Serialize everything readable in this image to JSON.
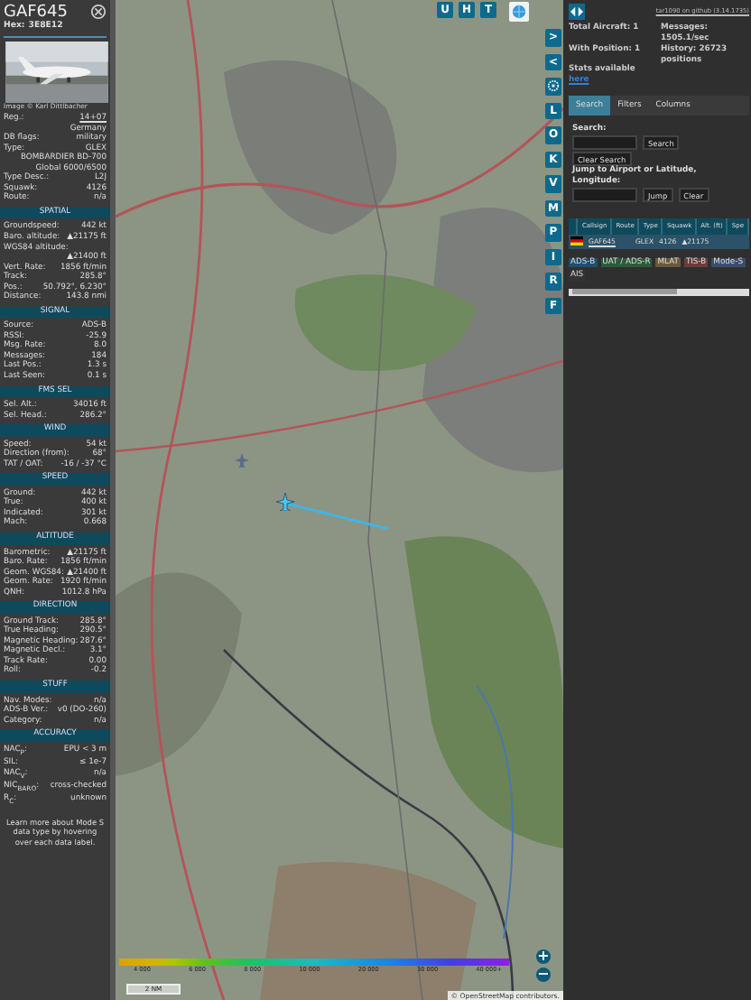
{
  "aircraft": {
    "callsign": "GAF645",
    "hex_label": "Hex:",
    "hex": "3E8E12",
    "photo": {
      "kind": "picture"
    },
    "photo_credit": "Image © Karl Dittlbacher"
  },
  "details": [
    {
      "label": "Reg.:",
      "value": "14+07",
      "link": true
    },
    {
      "value": "Germany"
    },
    {
      "label": "DB flags:",
      "value": "military"
    },
    {
      "label": "Type:",
      "value": "GLEX"
    },
    {
      "value": "BOMBARDIER BD-700 Global 6000/6500"
    },
    {
      "label": "Type Desc.:",
      "value": "L2J"
    },
    {
      "label": "Squawk:",
      "value": "4126"
    },
    {
      "label": "Route:",
      "value": "n/a"
    }
  ],
  "sections": [
    {
      "title": "SPATIAL",
      "rows": [
        {
          "label": "Groundspeed:",
          "value": "442 kt"
        },
        {
          "label": "Baro. altitude:",
          "value": "▲21175 ft"
        },
        {
          "label": "WGS84 altitude:"
        },
        {
          "value": "▲21400 ft"
        },
        {
          "label": "Vert. Rate:",
          "value": "1856 ft/min"
        },
        {
          "label": "Track:",
          "value": "285.8°"
        },
        {
          "label": "Pos.:",
          "value": "50.792°, 6.230°"
        },
        {
          "label": "Distance:",
          "value": "143.8 nmi"
        }
      ]
    },
    {
      "title": "SIGNAL",
      "rows": [
        {
          "label": "Source:",
          "value": "ADS-B"
        },
        {
          "label": "RSSI:",
          "value": "-25.9"
        },
        {
          "label": "Msg. Rate:",
          "value": "8.0"
        },
        {
          "label": "Messages:",
          "value": "184"
        },
        {
          "label": "Last Pos.:",
          "value": "1.3 s"
        },
        {
          "label": "Last Seen:",
          "value": "0.1 s"
        }
      ]
    },
    {
      "title": "FMS SEL",
      "rows": [
        {
          "label": "Sel. Alt.:",
          "value": "34016 ft"
        },
        {
          "label": "Sel. Head.:",
          "value": "286.2°"
        }
      ]
    },
    {
      "title": "WIND",
      "rows": [
        {
          "label": "Speed:",
          "value": "54 kt"
        },
        {
          "label": "Direction (from):",
          "value": "68°"
        },
        {
          "label": "TAT / OAT:",
          "value": "-16 / -37 °C"
        }
      ]
    },
    {
      "title": "SPEED",
      "rows": [
        {
          "label": "Ground:",
          "value": "442 kt"
        },
        {
          "label": "True:",
          "value": "400 kt"
        },
        {
          "label": "Indicated:",
          "value": "301 kt"
        },
        {
          "label": "Mach:",
          "value": "0.668"
        }
      ]
    },
    {
      "title": "ALTITUDE",
      "rows": [
        {
          "label": "Barometric:",
          "value": "▲21175 ft"
        },
        {
          "label": "Baro. Rate:",
          "value": "1856 ft/min"
        },
        {
          "label": "Geom. WGS84:",
          "value": "▲21400 ft"
        },
        {
          "label": "Geom. Rate:",
          "value": "1920 ft/min"
        },
        {
          "label": "QNH:",
          "value": "1012.8 hPa"
        }
      ]
    },
    {
      "title": "DIRECTION",
      "rows": [
        {
          "label": "Ground Track:",
          "value": "285.8°"
        },
        {
          "label": "True Heading:",
          "value": "290.5°"
        },
        {
          "label": "Magnetic Heading:",
          "value": "287.6°"
        },
        {
          "label": "Magnetic Decl.:",
          "value": "3.1°"
        },
        {
          "label": "Track Rate:",
          "value": "0.00"
        },
        {
          "label": "Roll:",
          "value": "-0.2"
        }
      ]
    },
    {
      "title": "STUFF",
      "rows": [
        {
          "label": "Nav. Modes:",
          "value": "n/a"
        },
        {
          "label": "ADS-B Ver.:",
          "value": "v0 (DO-260)"
        },
        {
          "label": "Category:",
          "value": "n/a"
        }
      ]
    },
    {
      "title": "ACCURACY",
      "rows": [
        {
          "label": "NAC$_{P}$:",
          "value": "EPU < 3 m"
        },
        {
          "label": "SIL:",
          "value": "≤ 1e-7"
        },
        {
          "label": "NAC$_{V}$:",
          "value": "n/a"
        },
        {
          "label": "NIC$_{BARO}$:",
          "value": "cross-checked"
        },
        {
          "label": "R$_{C}$:",
          "value": "unknown"
        }
      ]
    }
  ],
  "footer_note": "Learn more about Mode S data type by hovering over each data label.",
  "map": {
    "picture": {
      "kind": "picture"
    },
    "toolbar": [
      "U",
      "H",
      "T"
    ],
    "side_buttons": [
      {
        "kind": "text",
        "label": ">"
      },
      {
        "kind": "text",
        "label": "<"
      },
      {
        "kind": "gear"
      },
      {
        "kind": "text",
        "label": "L"
      },
      {
        "kind": "text",
        "label": "O"
      },
      {
        "kind": "text",
        "label": "K"
      },
      {
        "kind": "text",
        "label": "V"
      },
      {
        "kind": "text",
        "label": "M"
      },
      {
        "kind": "text",
        "label": "P"
      },
      {
        "kind": "text",
        "label": "I"
      },
      {
        "kind": "text",
        "label": "R"
      },
      {
        "kind": "text",
        "label": "F"
      }
    ],
    "legend": [
      "4 000",
      "6 000",
      "8 000",
      "10 000",
      "20 000",
      "30 000",
      "40 000+"
    ],
    "scale": "2 NM",
    "zoom_in": "+",
    "zoom_out": "−",
    "attribution": "© OpenStreetMap contributors."
  },
  "panel": {
    "version_link": "tar1090 on github (3.14.1735)",
    "stats": [
      {
        "label": "Total Aircraft: 1"
      },
      {
        "label": "Messages: 1505.1/sec"
      },
      {
        "label": "With Position: 1"
      },
      {
        "label": "History: 26723 positions"
      }
    ],
    "stats_note": "Stats available",
    "stats_link": "here",
    "tabs": [
      {
        "label": "Search",
        "selected": true
      },
      {
        "label": "Filters",
        "selected": false
      },
      {
        "label": "Columns",
        "selected": false
      }
    ],
    "search_label": "Search:",
    "search_button": "Search",
    "clear_search_button": "Clear Search",
    "jump_label": "Jump to Airport or Latitude, Longitude:",
    "jump_button": "Jump",
    "clear_button": "Clear",
    "columns": [
      "Callsign",
      "Route",
      "Type",
      "Squawk",
      "Alt. (ft)",
      "Spe"
    ],
    "rows": [
      {
        "callsign": "GAF645",
        "route": "",
        "type": "GLEX",
        "squawk": "4126",
        "altitude": "▲21175"
      }
    ],
    "sources": [
      {
        "label": "ADS-B",
        "color": "#1f4e6e"
      },
      {
        "label": "UAT / ADS-R",
        "color": "#2c5a3c"
      },
      {
        "label": "MLAT",
        "color": "#6b5a3c"
      },
      {
        "label": "TIS-B",
        "color": "#6b3c3c"
      },
      {
        "label": "Mode-S",
        "color": "#3c4c6c"
      },
      {
        "label": "AIS",
        "color": "#333333"
      }
    ]
  }
}
